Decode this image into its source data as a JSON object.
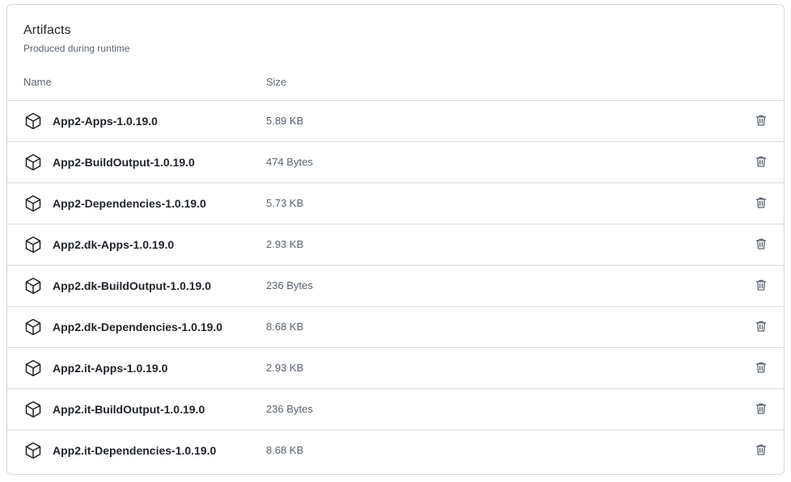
{
  "section": {
    "title": "Artifacts",
    "subtitle": "Produced during runtime"
  },
  "columns": {
    "name": "Name",
    "size": "Size"
  },
  "icons": {
    "artifact": "package-icon",
    "delete": "trash-icon"
  },
  "artifacts": [
    {
      "name": "App2-Apps-1.0.19.0",
      "size": "5.89 KB"
    },
    {
      "name": "App2-BuildOutput-1.0.19.0",
      "size": "474 Bytes"
    },
    {
      "name": "App2-Dependencies-1.0.19.0",
      "size": "5.73 KB"
    },
    {
      "name": "App2.dk-Apps-1.0.19.0",
      "size": "2.93 KB"
    },
    {
      "name": "App2.dk-BuildOutput-1.0.19.0",
      "size": "236 Bytes"
    },
    {
      "name": "App2.dk-Dependencies-1.0.19.0",
      "size": "8.68 KB"
    },
    {
      "name": "App2.it-Apps-1.0.19.0",
      "size": "2.93 KB"
    },
    {
      "name": "App2.it-BuildOutput-1.0.19.0",
      "size": "236 Bytes"
    },
    {
      "name": "App2.it-Dependencies-1.0.19.0",
      "size": "8.68 KB"
    }
  ]
}
